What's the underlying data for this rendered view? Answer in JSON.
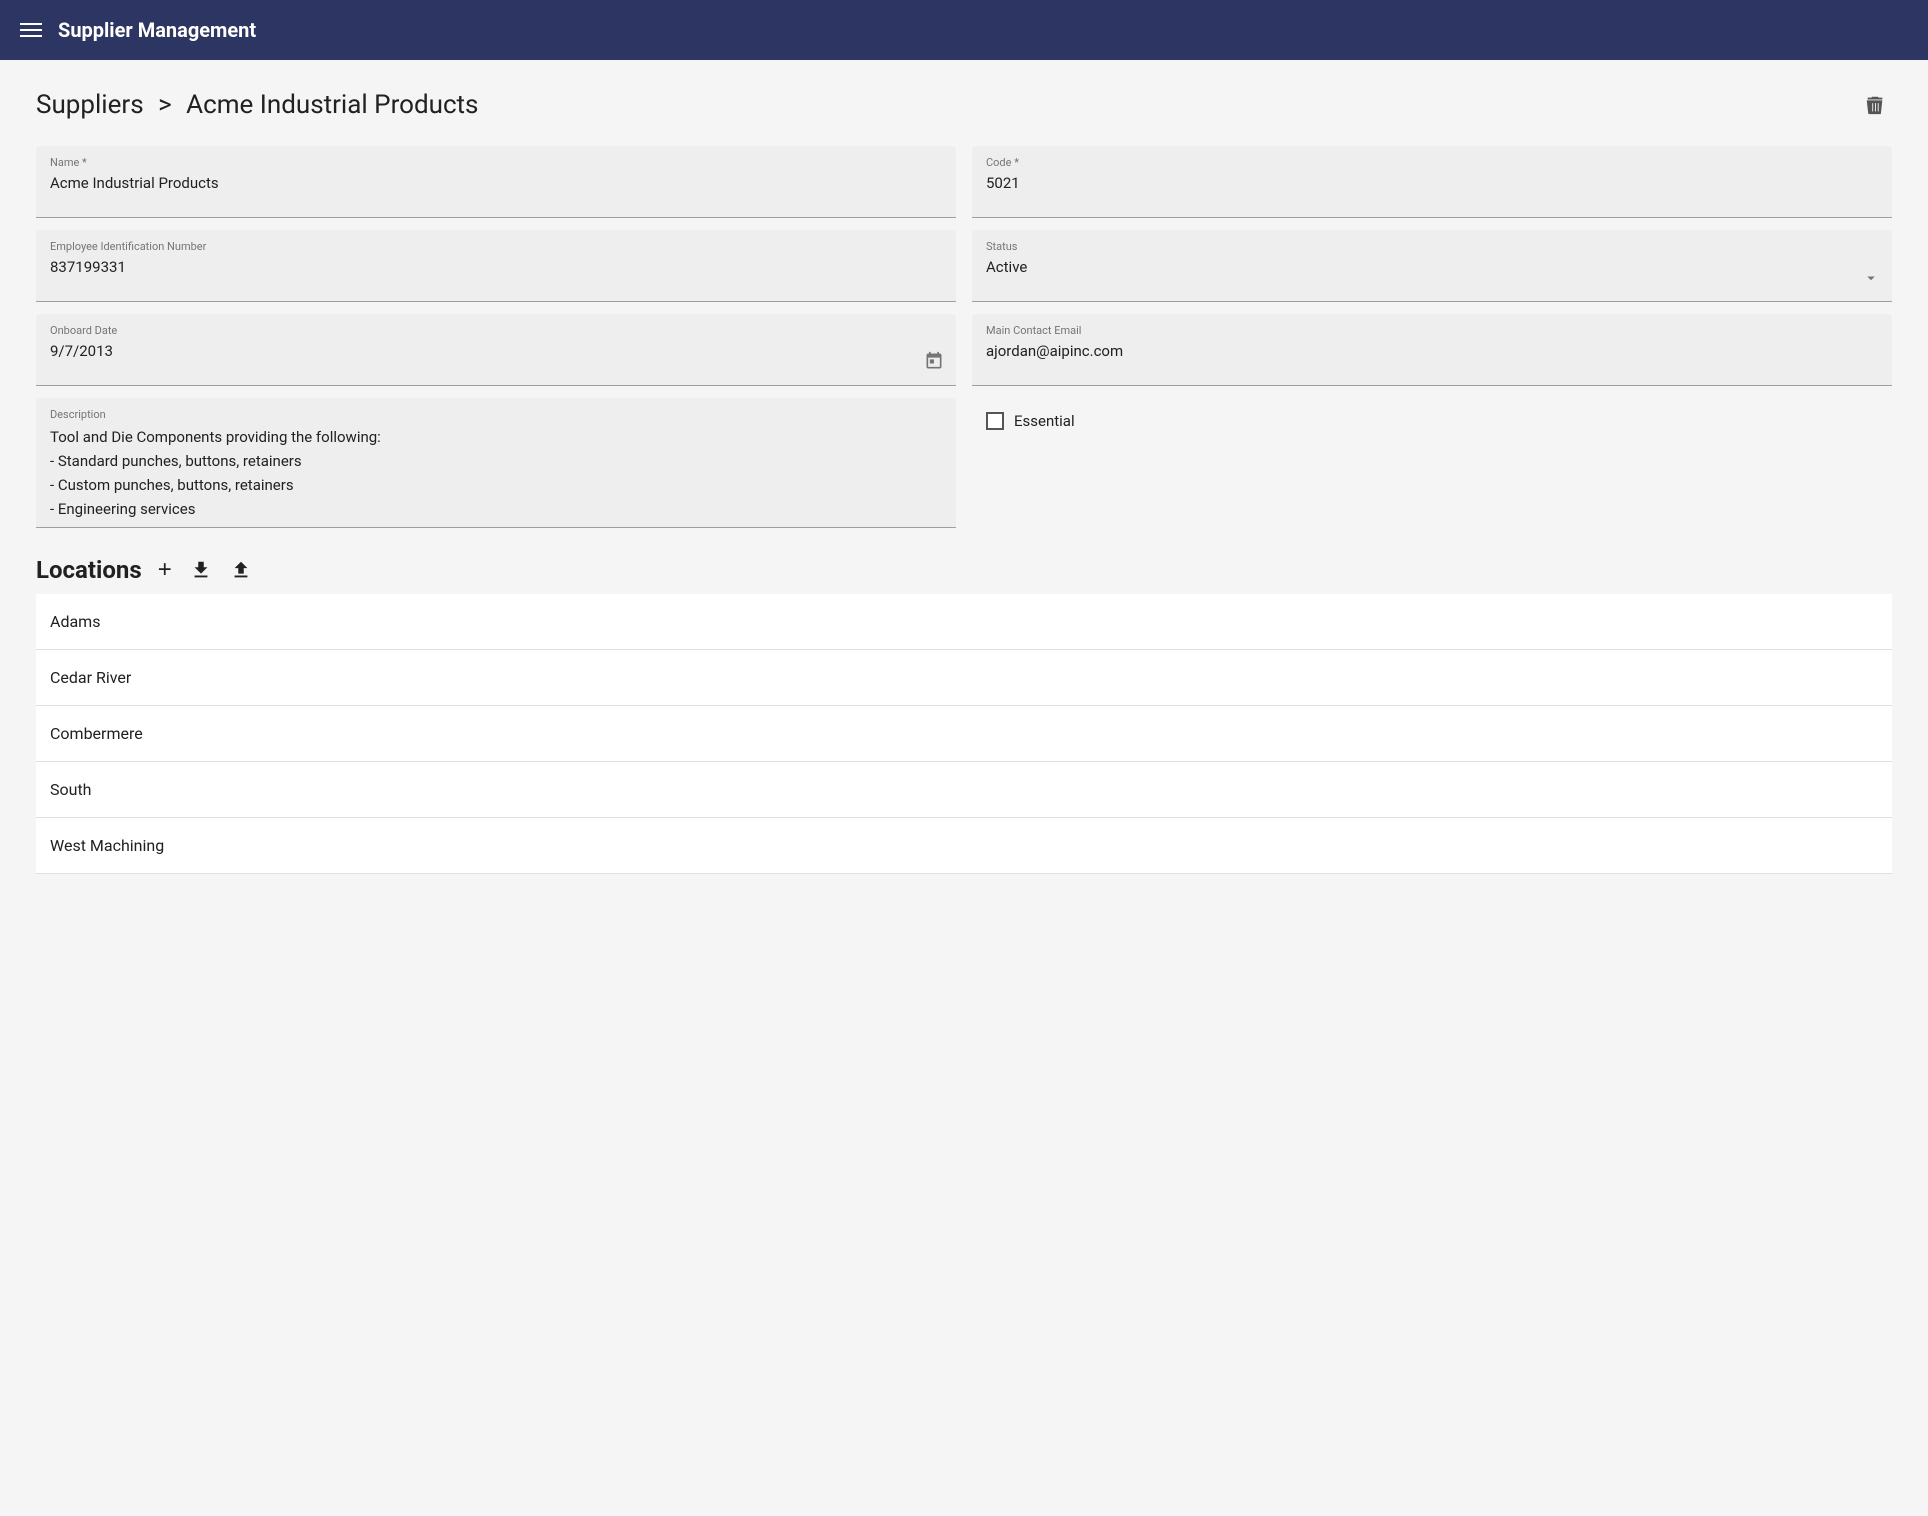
{
  "header": {
    "title": "Supplier Management",
    "menu_icon_label": "menu"
  },
  "breadcrumb": {
    "parent": "Suppliers",
    "separator": ">",
    "current": "Acme Industrial Products"
  },
  "form": {
    "name_label": "Name *",
    "name_value": "Acme Industrial Products",
    "code_label": "Code *",
    "code_value": "5021",
    "ein_label": "Employee Identification Number",
    "ein_value": "837199331",
    "status_label": "Status",
    "status_value": "Active",
    "onboard_label": "Onboard Date",
    "onboard_value": "9/7/2013",
    "contact_email_label": "Main Contact Email",
    "contact_email_value": "ajordan@aipinc.com",
    "description_label": "Description",
    "description_value": "Tool and Die Components providing the following:\n- Standard punches, buttons, retainers\n- Custom punches, buttons, retainers\n- Engineering services",
    "essential_label": "Essential"
  },
  "locations": {
    "title": "Locations",
    "add_button_label": "+",
    "items": [
      {
        "name": "Adams"
      },
      {
        "name": "Cedar River"
      },
      {
        "name": "Combermere"
      },
      {
        "name": "South"
      },
      {
        "name": "West Machining"
      }
    ]
  },
  "icons": {
    "delete": "trash",
    "calendar": "calendar",
    "dropdown": "chevron-down",
    "download": "download",
    "upload": "upload"
  }
}
